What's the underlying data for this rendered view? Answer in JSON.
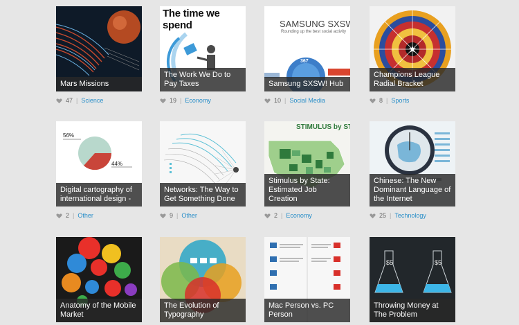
{
  "cards": [
    {
      "title": "Mars Missions",
      "likes": "47",
      "category": "Science"
    },
    {
      "title": "The Work We Do to Pay Taxes",
      "likes": "19",
      "category": "Economy",
      "thumb_heading": "The time we spend"
    },
    {
      "title": "Samsung SXSW! Hub",
      "likes": "10",
      "category": "Social Media",
      "thumb_heading": "SAMSUNG SXSW",
      "thumb_sub": "Rounding up the best social activity",
      "thumb_stat": "367"
    },
    {
      "title": "Champions League Radial Bracket",
      "likes": "8",
      "category": "Sports"
    },
    {
      "title": "Digital cartography of international design -",
      "likes": "2",
      "category": "Other",
      "thumb_top_pct": "56%",
      "thumb_bottom_pct": "44%"
    },
    {
      "title": "Networks: The Way to Get Something Done",
      "likes": "9",
      "category": "Other"
    },
    {
      "title": "Stimulus by State: Estimated Job Creation",
      "likes": "2",
      "category": "Economy",
      "thumb_heading": "STIMULUS by STA"
    },
    {
      "title": "Chinese: The New Dominant Language of the Internet",
      "likes": "25",
      "category": "Technology"
    },
    {
      "title": "Anatomy of the Mobile Market",
      "likes": "",
      "category": ""
    },
    {
      "title": "The Evolution of Typography",
      "likes": "",
      "category": ""
    },
    {
      "title": "Mac Person vs. PC Person",
      "likes": "",
      "category": ""
    },
    {
      "title": "Throwing Money at The Problem",
      "likes": "",
      "category": ""
    }
  ],
  "colors": {
    "category_link": "#2a8fc9",
    "caption_bg": "#282828",
    "page_bg": "#e6e6e6"
  }
}
